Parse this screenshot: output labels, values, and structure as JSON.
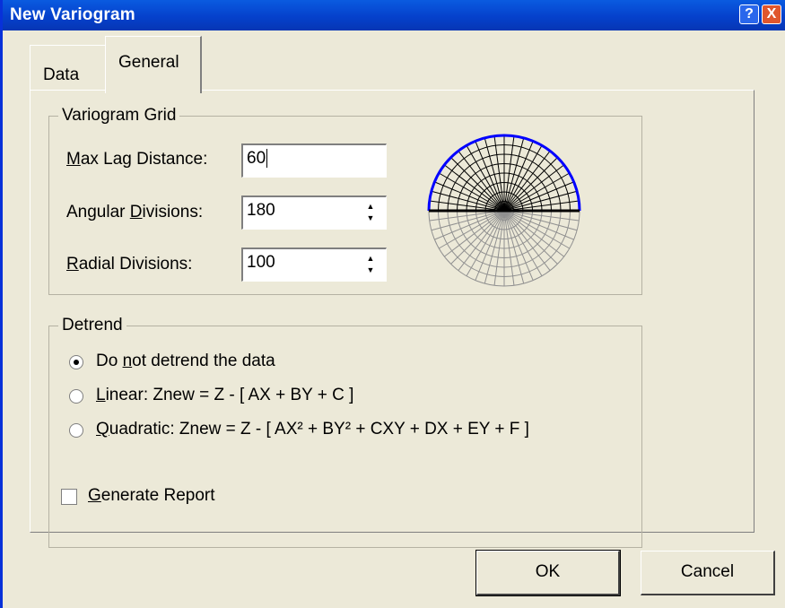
{
  "window": {
    "title": "New Variogram",
    "help_glyph": "?",
    "close_glyph": "X"
  },
  "tabs": [
    {
      "label": "Data"
    },
    {
      "label": "General"
    }
  ],
  "variogram_grid": {
    "legend": "Variogram Grid",
    "max_lag": {
      "label_u": "M",
      "label_rest": "ax Lag Distance:",
      "value": "60"
    },
    "angular": {
      "label_pre": "Angular ",
      "label_u": "D",
      "label_rest": "ivisions:",
      "value": "180"
    },
    "radial": {
      "label_u": "R",
      "label_rest": "adial Divisions:",
      "value": "100"
    },
    "spin_up": "▲",
    "spin_down": "▼"
  },
  "detrend": {
    "legend": "Detrend",
    "options": [
      {
        "pre": "Do ",
        "u": "n",
        "rest": "ot detrend the data",
        "selected": true
      },
      {
        "pre": "",
        "u": "L",
        "rest": "inear:  Znew  =  Z - [ AX + BY + C ]",
        "selected": false
      },
      {
        "pre": "",
        "u": "Q",
        "rest": "uadratic:  Znew  =  Z - [ AX² + BY² + CXY + DX + EY + F ]",
        "selected": false
      }
    ]
  },
  "generate_report": {
    "u": "G",
    "rest": "enerate Report",
    "checked": false
  },
  "buttons": {
    "ok": "OK",
    "cancel": "Cancel"
  },
  "colors": {
    "titlebar": "#0a5be0",
    "face": "#ece9d8",
    "grid_upper": "#000000",
    "grid_lower": "#909090",
    "arc": "#0000ff"
  }
}
